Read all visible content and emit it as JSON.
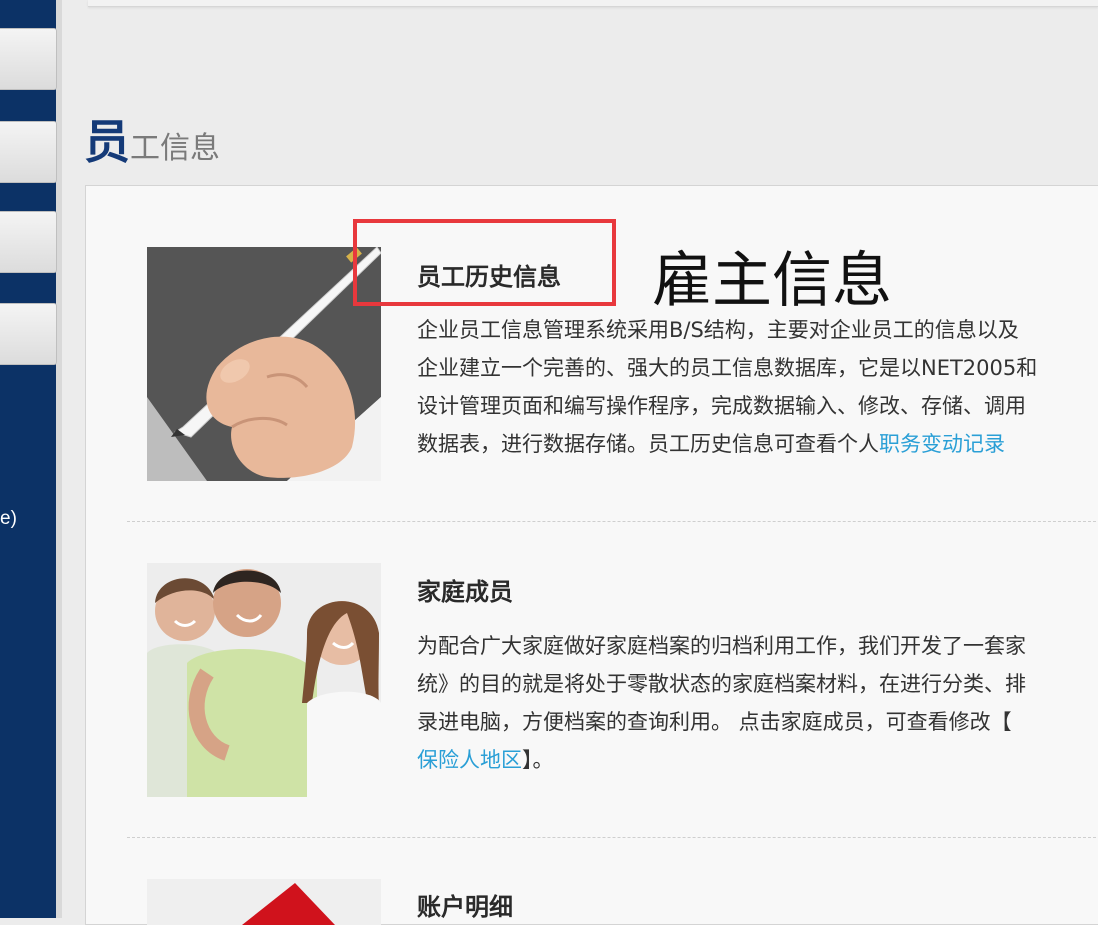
{
  "sidebar": {
    "fragment_text": "e)"
  },
  "section": {
    "title_big": "员",
    "title_small": "工信息"
  },
  "items": [
    {
      "title": "员工历史信息",
      "desc_lines": [
        "企业员工信息管理系统采用B/S结构，主要对企业员工的信息以及",
        "企业建立一个完善的、强大的员工信息数据库，它是以NET2005和",
        "设计管理页面和编写操作程序，完成数据输入、修改、存储、调用",
        "数据表，进行数据存储。员工历史信息可查看个人"
      ],
      "link": "职务变动记录"
    },
    {
      "title": "家庭成员",
      "desc_lines": [
        "为配合广大家庭做好家庭档案的归档利用工作，我们开发了一套家",
        "统》的目的就是将处于零散状态的家庭档案材料，在进行分类、排",
        "录进电脑，方便档案的查询利用。 点击家庭成员，可查看修改【"
      ],
      "link": "保险人地区",
      "tail": "】。"
    },
    {
      "title": "账户明细"
    }
  ],
  "annotation": {
    "text": "雇主信息"
  },
  "colors": {
    "sidebar": "#0c3266",
    "title_accent": "#143a78",
    "link": "#2a9fd6",
    "highlight": "#e8383d"
  }
}
